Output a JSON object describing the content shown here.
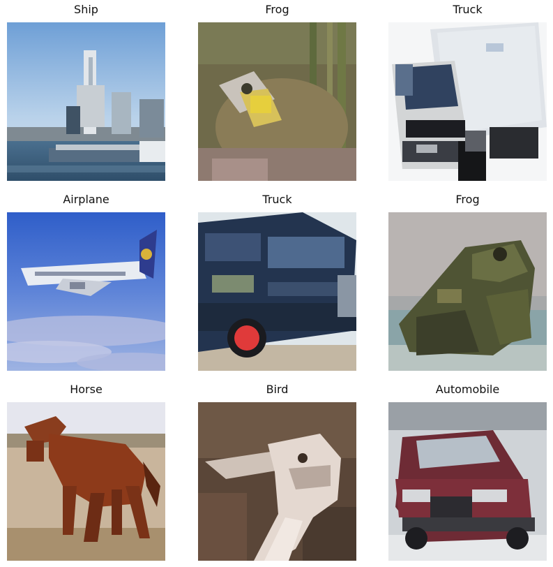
{
  "grid": {
    "items": [
      {
        "label": "Ship",
        "image": "ship-photo"
      },
      {
        "label": "Frog",
        "image": "frog-photo"
      },
      {
        "label": "Truck",
        "image": "truck-photo"
      },
      {
        "label": "Airplane",
        "image": "airplane-photo"
      },
      {
        "label": "Truck",
        "image": "truck-photo"
      },
      {
        "label": "Frog",
        "image": "frog-photo"
      },
      {
        "label": "Horse",
        "image": "horse-photo"
      },
      {
        "label": "Bird",
        "image": "bird-photo"
      },
      {
        "label": "Automobile",
        "image": "automobile-photo"
      }
    ]
  }
}
